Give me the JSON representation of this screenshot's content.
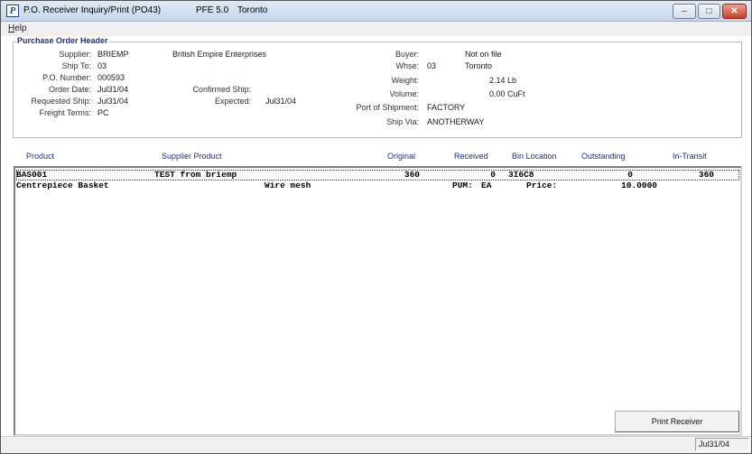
{
  "window": {
    "icon_letter": "P",
    "title": "P.O. Receiver Inquiry/Print (PO43)",
    "version": "PFE 5.0",
    "location": "Toronto",
    "minimize_glyph": "–",
    "restore_glyph": "□",
    "close_glyph": "✕"
  },
  "menu": {
    "help_first": "H",
    "help_rest": "elp"
  },
  "header": {
    "group_title": "Purchase Order Header",
    "supplier_label": "Supplier:",
    "supplier_code": "BRIEMP",
    "supplier_name": "British Empire Enterprises",
    "shipto_label": "Ship To:",
    "shipto": "03",
    "ponum_label": "P.O. Number:",
    "ponum": "000593",
    "orderdate_label": "Order Date:",
    "orderdate": "Jul31/04",
    "confirmed_label": "Confirmed Ship:",
    "reqship_label": "Requested Ship:",
    "reqship": "Jul31/04",
    "expected_label": "Expected:",
    "expected": "Jul31/04",
    "freight_label": "Freight Terms:",
    "freight": "PC",
    "buyer_label": "Buyer:",
    "buyer": "Not on file",
    "whse_label": "Whse:",
    "whse_code": "03",
    "whse_name": "Toronto",
    "weight_label": "Weight:",
    "weight": "2.14 Lb",
    "volume_label": "Volume:",
    "volume": "0.00 CuFt",
    "port_label": "Port of Shipment:",
    "port": "FACTORY",
    "shipvia_label": "Ship Via:",
    "shipvia": "ANOTHERWAY"
  },
  "columns": {
    "product": "Product",
    "supplier_product": "Supplier Product",
    "original": "Original",
    "received": "Received",
    "bin": "Bin Location",
    "outstanding": "Outstanding",
    "intransit": "In-Transit"
  },
  "rows": [
    {
      "product": "BAS001",
      "supplier_product": "TEST from briemp",
      "original": "360",
      "received": "0",
      "bin": "3I6C8",
      "outstanding": "0",
      "intransit": "360",
      "description": "Centrepiece Basket",
      "supplier_desc": "Wire mesh",
      "pum_label": "PUM:",
      "pum": "EA",
      "price_label": "Price:",
      "price": "10.0000"
    }
  ],
  "buttons": {
    "print_receiver": "Print Receiver"
  },
  "status": {
    "date": "Jul31/04"
  }
}
